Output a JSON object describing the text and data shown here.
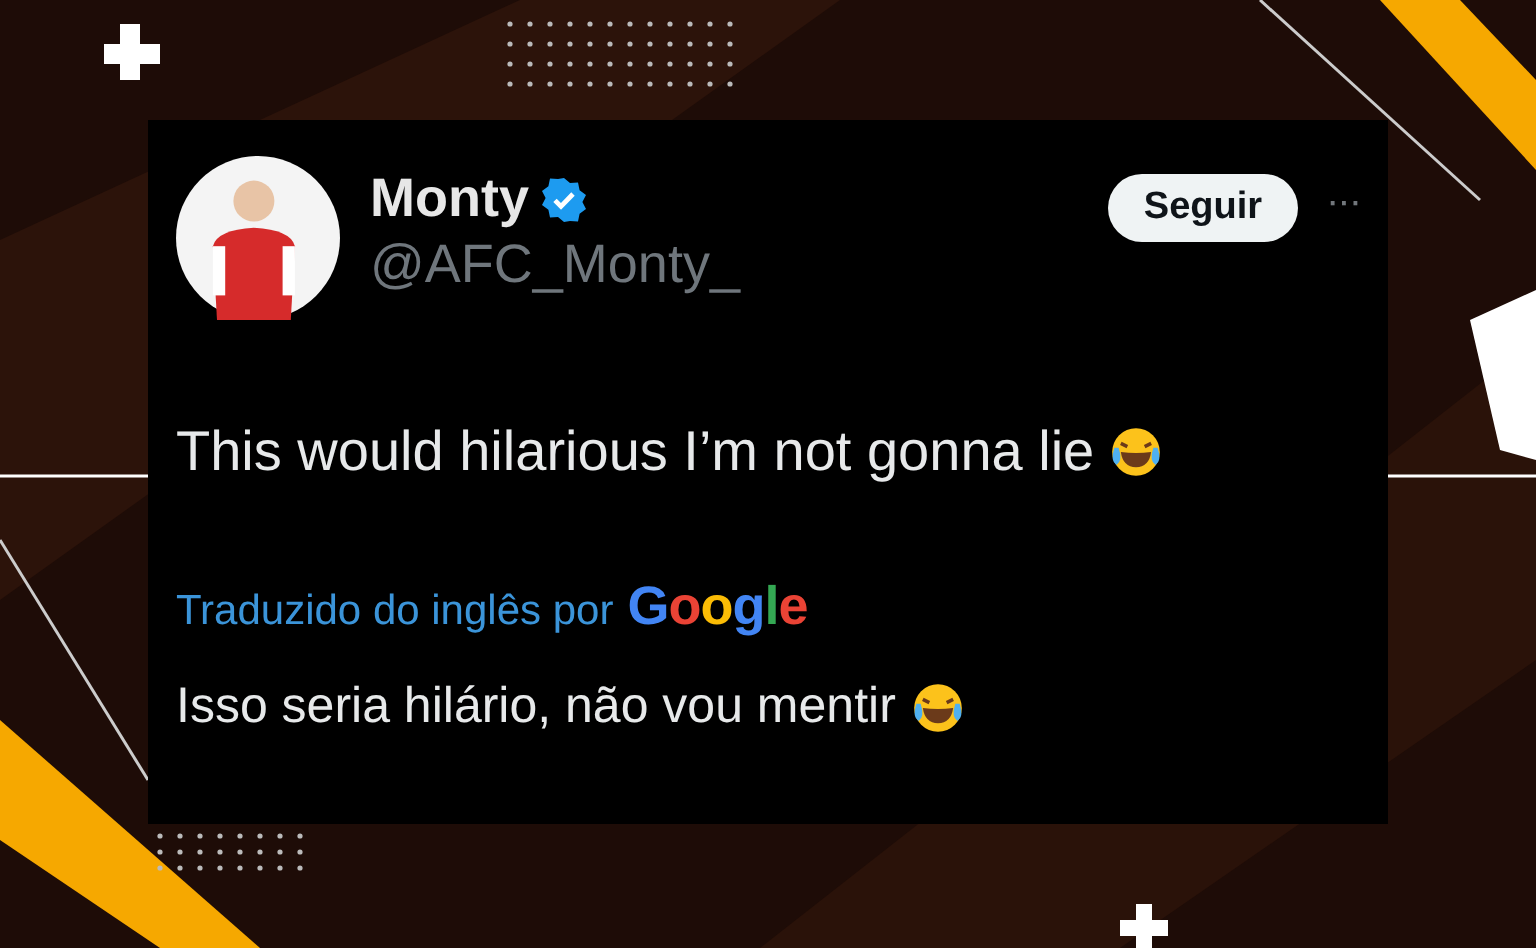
{
  "tweet": {
    "name": "Monty",
    "verified": true,
    "handle": "@AFC_Monty_",
    "follow_button": "Seguir",
    "more": "···",
    "text": "This would hilarious I’m not gonna lie",
    "text_emoji": true,
    "translation_label": "Traduzido do inglês por",
    "translation_brand": "Google",
    "translation": "Isso seria hilário, não vou mentir",
    "translation_emoji": true
  }
}
